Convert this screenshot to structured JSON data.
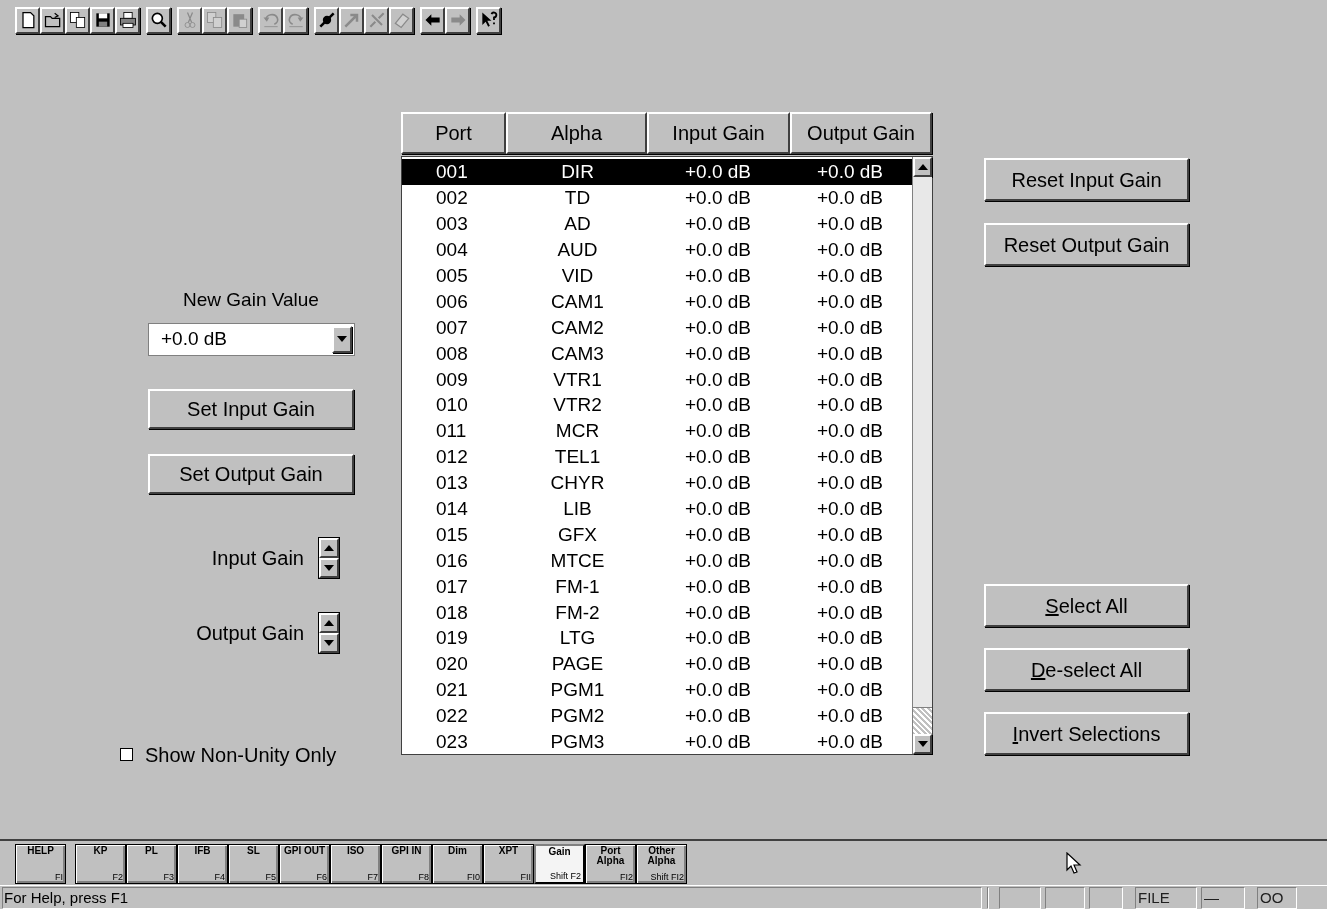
{
  "toolbar": {
    "groups": [
      [
        {
          "kind": "new",
          "enabled": true
        },
        {
          "kind": "open",
          "enabled": true
        },
        {
          "kind": "copy-doc",
          "enabled": true
        },
        {
          "kind": "save",
          "enabled": true
        },
        {
          "kind": "print",
          "enabled": true
        }
      ],
      [
        {
          "kind": "zoom",
          "enabled": true
        }
      ],
      [
        {
          "kind": "cut",
          "enabled": false
        },
        {
          "kind": "copy",
          "enabled": false
        },
        {
          "kind": "paste",
          "enabled": false
        }
      ],
      [
        {
          "kind": "undo",
          "enabled": false
        },
        {
          "kind": "redo",
          "enabled": false
        }
      ],
      [
        {
          "kind": "connect",
          "enabled": true
        },
        {
          "kind": "arrow",
          "enabled": false
        },
        {
          "kind": "disconnect",
          "enabled": false
        },
        {
          "kind": "erase",
          "enabled": false
        }
      ],
      [
        {
          "kind": "back",
          "enabled": true
        },
        {
          "kind": "forward",
          "enabled": false
        }
      ],
      [
        {
          "kind": "help",
          "enabled": true
        }
      ]
    ]
  },
  "left_panel": {
    "new_gain_label": "New Gain Value",
    "new_gain_value": "+0.0 dB",
    "buttons": [
      "Set Input Gain",
      "Set Output Gain"
    ],
    "spinners": [
      "Input Gain",
      "Output Gain"
    ],
    "checkbox": {
      "label": "Show Non-Unity Only",
      "checked": false
    }
  },
  "table": {
    "columns": [
      "Port",
      "Alpha",
      "Input Gain",
      "Output Gain"
    ],
    "rows": [
      {
        "port": "001",
        "alpha": "DIR",
        "input": "+0.0 dB",
        "output": "+0.0 dB",
        "selected": true
      },
      {
        "port": "002",
        "alpha": "TD",
        "input": "+0.0 dB",
        "output": "+0.0 dB",
        "selected": false
      },
      {
        "port": "003",
        "alpha": "AD",
        "input": "+0.0 dB",
        "output": "+0.0 dB",
        "selected": false
      },
      {
        "port": "004",
        "alpha": "AUD",
        "input": "+0.0 dB",
        "output": "+0.0 dB",
        "selected": false
      },
      {
        "port": "005",
        "alpha": "VID",
        "input": "+0.0 dB",
        "output": "+0.0 dB",
        "selected": false
      },
      {
        "port": "006",
        "alpha": "CAM1",
        "input": "+0.0 dB",
        "output": "+0.0 dB",
        "selected": false
      },
      {
        "port": "007",
        "alpha": "CAM2",
        "input": "+0.0 dB",
        "output": "+0.0 dB",
        "selected": false
      },
      {
        "port": "008",
        "alpha": "CAM3",
        "input": "+0.0 dB",
        "output": "+0.0 dB",
        "selected": false
      },
      {
        "port": "009",
        "alpha": "VTR1",
        "input": "+0.0 dB",
        "output": "+0.0 dB",
        "selected": false
      },
      {
        "port": "010",
        "alpha": "VTR2",
        "input": "+0.0 dB",
        "output": "+0.0 dB",
        "selected": false
      },
      {
        "port": "011",
        "alpha": "MCR",
        "input": "+0.0 dB",
        "output": "+0.0 dB",
        "selected": false
      },
      {
        "port": "012",
        "alpha": "TEL1",
        "input": "+0.0 dB",
        "output": "+0.0 dB",
        "selected": false
      },
      {
        "port": "013",
        "alpha": "CHYR",
        "input": "+0.0 dB",
        "output": "+0.0 dB",
        "selected": false
      },
      {
        "port": "014",
        "alpha": "LIB",
        "input": "+0.0 dB",
        "output": "+0.0 dB",
        "selected": false
      },
      {
        "port": "015",
        "alpha": "GFX",
        "input": "+0.0 dB",
        "output": "+0.0 dB",
        "selected": false
      },
      {
        "port": "016",
        "alpha": "MTCE",
        "input": "+0.0 dB",
        "output": "+0.0 dB",
        "selected": false
      },
      {
        "port": "017",
        "alpha": "FM-1",
        "input": "+0.0 dB",
        "output": "+0.0 dB",
        "selected": false
      },
      {
        "port": "018",
        "alpha": "FM-2",
        "input": "+0.0 dB",
        "output": "+0.0 dB",
        "selected": false
      },
      {
        "port": "019",
        "alpha": "LTG",
        "input": "+0.0 dB",
        "output": "+0.0 dB",
        "selected": false
      },
      {
        "port": "020",
        "alpha": "PAGE",
        "input": "+0.0 dB",
        "output": "+0.0 dB",
        "selected": false
      },
      {
        "port": "021",
        "alpha": "PGM1",
        "input": "+0.0 dB",
        "output": "+0.0 dB",
        "selected": false
      },
      {
        "port": "022",
        "alpha": "PGM2",
        "input": "+0.0 dB",
        "output": "+0.0 dB",
        "selected": false
      },
      {
        "port": "023",
        "alpha": "PGM3",
        "input": "+0.0 dB",
        "output": "+0.0 dB",
        "selected": false
      }
    ]
  },
  "right_panel": {
    "top_buttons": [
      {
        "label": "Reset Input Gain",
        "underline_first": false
      },
      {
        "label": "Reset Output Gain",
        "underline_first": false
      }
    ],
    "bottom_buttons": [
      {
        "label": "Select All",
        "underline_first": true
      },
      {
        "label": "De-select All",
        "underline_first": true
      },
      {
        "label": "Invert Selections",
        "underline_first": true
      }
    ]
  },
  "function_keys": [
    {
      "label": "HELP",
      "key": "FI",
      "selected": false
    },
    {
      "label": "KP",
      "key": "F2",
      "selected": false
    },
    {
      "label": "PL",
      "key": "F3",
      "selected": false
    },
    {
      "label": "IFB",
      "key": "F4",
      "selected": false
    },
    {
      "label": "SL",
      "key": "F5",
      "selected": false
    },
    {
      "label": "GPI OUT",
      "key": "F6",
      "selected": false
    },
    {
      "label": "ISO",
      "key": "F7",
      "selected": false
    },
    {
      "label": "GPI IN",
      "key": "F8",
      "selected": false
    },
    {
      "label": "Dim",
      "key": "FI0",
      "selected": false
    },
    {
      "label": "XPT",
      "key": "FII",
      "selected": false
    },
    {
      "label": "Gain",
      "key": "Shift F2",
      "selected": true
    },
    {
      "label": "Port Alpha",
      "key": "FI2",
      "selected": false
    },
    {
      "label": "Other Alpha",
      "key": "Shift FI2",
      "selected": false
    }
  ],
  "status_bar": {
    "message": "For Help, press F1",
    "panes": [
      "FILE",
      "—",
      "OO"
    ]
  }
}
